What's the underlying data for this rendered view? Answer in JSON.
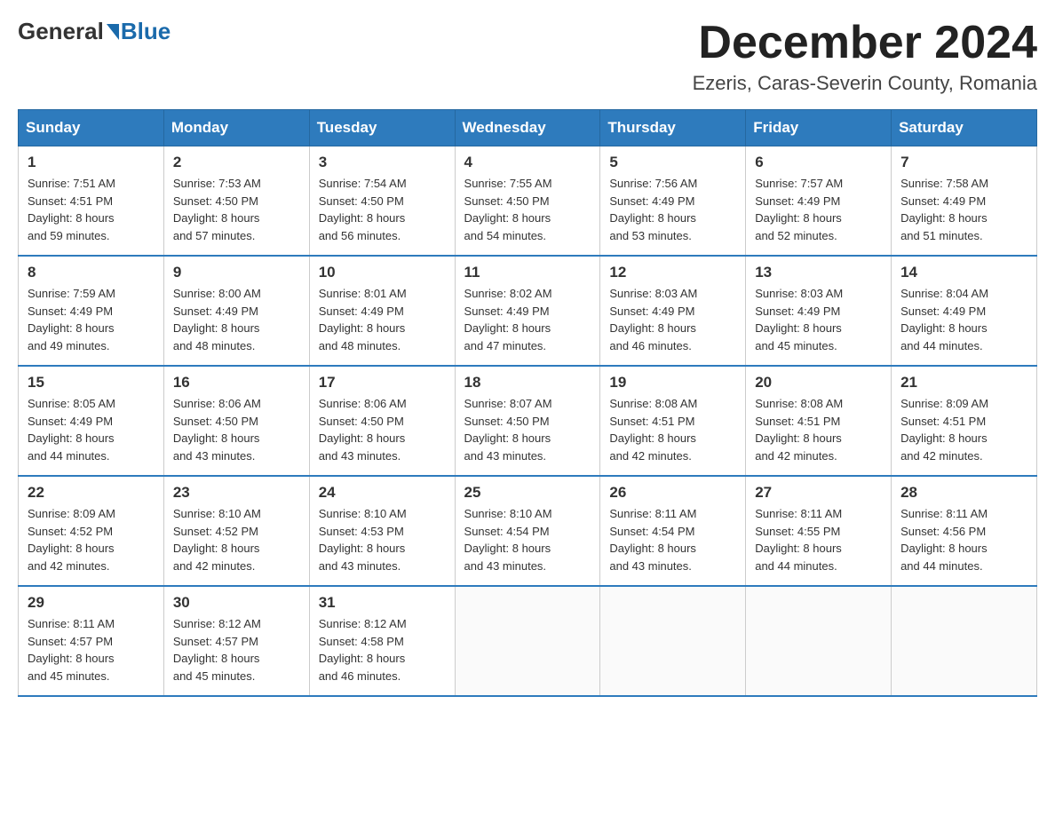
{
  "header": {
    "logo_general": "General",
    "logo_blue": "Blue",
    "month_year": "December 2024",
    "location": "Ezeris, Caras-Severin County, Romania"
  },
  "weekdays": [
    "Sunday",
    "Monday",
    "Tuesday",
    "Wednesday",
    "Thursday",
    "Friday",
    "Saturday"
  ],
  "weeks": [
    [
      {
        "day": "1",
        "sunrise": "7:51 AM",
        "sunset": "4:51 PM",
        "daylight": "8 hours and 59 minutes."
      },
      {
        "day": "2",
        "sunrise": "7:53 AM",
        "sunset": "4:50 PM",
        "daylight": "8 hours and 57 minutes."
      },
      {
        "day": "3",
        "sunrise": "7:54 AM",
        "sunset": "4:50 PM",
        "daylight": "8 hours and 56 minutes."
      },
      {
        "day": "4",
        "sunrise": "7:55 AM",
        "sunset": "4:50 PM",
        "daylight": "8 hours and 54 minutes."
      },
      {
        "day": "5",
        "sunrise": "7:56 AM",
        "sunset": "4:49 PM",
        "daylight": "8 hours and 53 minutes."
      },
      {
        "day": "6",
        "sunrise": "7:57 AM",
        "sunset": "4:49 PM",
        "daylight": "8 hours and 52 minutes."
      },
      {
        "day": "7",
        "sunrise": "7:58 AM",
        "sunset": "4:49 PM",
        "daylight": "8 hours and 51 minutes."
      }
    ],
    [
      {
        "day": "8",
        "sunrise": "7:59 AM",
        "sunset": "4:49 PM",
        "daylight": "8 hours and 49 minutes."
      },
      {
        "day": "9",
        "sunrise": "8:00 AM",
        "sunset": "4:49 PM",
        "daylight": "8 hours and 48 minutes."
      },
      {
        "day": "10",
        "sunrise": "8:01 AM",
        "sunset": "4:49 PM",
        "daylight": "8 hours and 48 minutes."
      },
      {
        "day": "11",
        "sunrise": "8:02 AM",
        "sunset": "4:49 PM",
        "daylight": "8 hours and 47 minutes."
      },
      {
        "day": "12",
        "sunrise": "8:03 AM",
        "sunset": "4:49 PM",
        "daylight": "8 hours and 46 minutes."
      },
      {
        "day": "13",
        "sunrise": "8:03 AM",
        "sunset": "4:49 PM",
        "daylight": "8 hours and 45 minutes."
      },
      {
        "day": "14",
        "sunrise": "8:04 AM",
        "sunset": "4:49 PM",
        "daylight": "8 hours and 44 minutes."
      }
    ],
    [
      {
        "day": "15",
        "sunrise": "8:05 AM",
        "sunset": "4:49 PM",
        "daylight": "8 hours and 44 minutes."
      },
      {
        "day": "16",
        "sunrise": "8:06 AM",
        "sunset": "4:50 PM",
        "daylight": "8 hours and 43 minutes."
      },
      {
        "day": "17",
        "sunrise": "8:06 AM",
        "sunset": "4:50 PM",
        "daylight": "8 hours and 43 minutes."
      },
      {
        "day": "18",
        "sunrise": "8:07 AM",
        "sunset": "4:50 PM",
        "daylight": "8 hours and 43 minutes."
      },
      {
        "day": "19",
        "sunrise": "8:08 AM",
        "sunset": "4:51 PM",
        "daylight": "8 hours and 42 minutes."
      },
      {
        "day": "20",
        "sunrise": "8:08 AM",
        "sunset": "4:51 PM",
        "daylight": "8 hours and 42 minutes."
      },
      {
        "day": "21",
        "sunrise": "8:09 AM",
        "sunset": "4:51 PM",
        "daylight": "8 hours and 42 minutes."
      }
    ],
    [
      {
        "day": "22",
        "sunrise": "8:09 AM",
        "sunset": "4:52 PM",
        "daylight": "8 hours and 42 minutes."
      },
      {
        "day": "23",
        "sunrise": "8:10 AM",
        "sunset": "4:52 PM",
        "daylight": "8 hours and 42 minutes."
      },
      {
        "day": "24",
        "sunrise": "8:10 AM",
        "sunset": "4:53 PM",
        "daylight": "8 hours and 43 minutes."
      },
      {
        "day": "25",
        "sunrise": "8:10 AM",
        "sunset": "4:54 PM",
        "daylight": "8 hours and 43 minutes."
      },
      {
        "day": "26",
        "sunrise": "8:11 AM",
        "sunset": "4:54 PM",
        "daylight": "8 hours and 43 minutes."
      },
      {
        "day": "27",
        "sunrise": "8:11 AM",
        "sunset": "4:55 PM",
        "daylight": "8 hours and 44 minutes."
      },
      {
        "day": "28",
        "sunrise": "8:11 AM",
        "sunset": "4:56 PM",
        "daylight": "8 hours and 44 minutes."
      }
    ],
    [
      {
        "day": "29",
        "sunrise": "8:11 AM",
        "sunset": "4:57 PM",
        "daylight": "8 hours and 45 minutes."
      },
      {
        "day": "30",
        "sunrise": "8:12 AM",
        "sunset": "4:57 PM",
        "daylight": "8 hours and 45 minutes."
      },
      {
        "day": "31",
        "sunrise": "8:12 AM",
        "sunset": "4:58 PM",
        "daylight": "8 hours and 46 minutes."
      },
      null,
      null,
      null,
      null
    ]
  ]
}
